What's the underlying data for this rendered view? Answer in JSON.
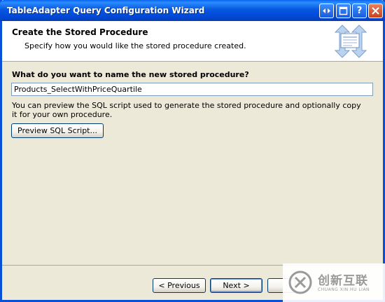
{
  "window": {
    "title": "TableAdapter Query Configuration Wizard"
  },
  "header": {
    "title": "Create the Stored Procedure",
    "subtitle": "Specify how you would like the stored procedure created."
  },
  "main": {
    "question_label": "What do you want to name the new stored procedure?",
    "procedure_name_value": "Products_SelectWithPriceQuartile",
    "preview_description": "You can preview the SQL script used to generate the stored procedure and optionally copy it for your own procedure.",
    "preview_button_label": "Preview SQL Script..."
  },
  "footer": {
    "previous_label": "< Previous",
    "next_label": "Next >"
  },
  "watermark": {
    "brand_cn": "创新互联",
    "brand_en": "CHUANG XIN HU LIAN"
  },
  "colors": {
    "titlebar": "#0758e0",
    "dialog_bg": "#ece9d8",
    "header_bg": "#ffffff"
  }
}
